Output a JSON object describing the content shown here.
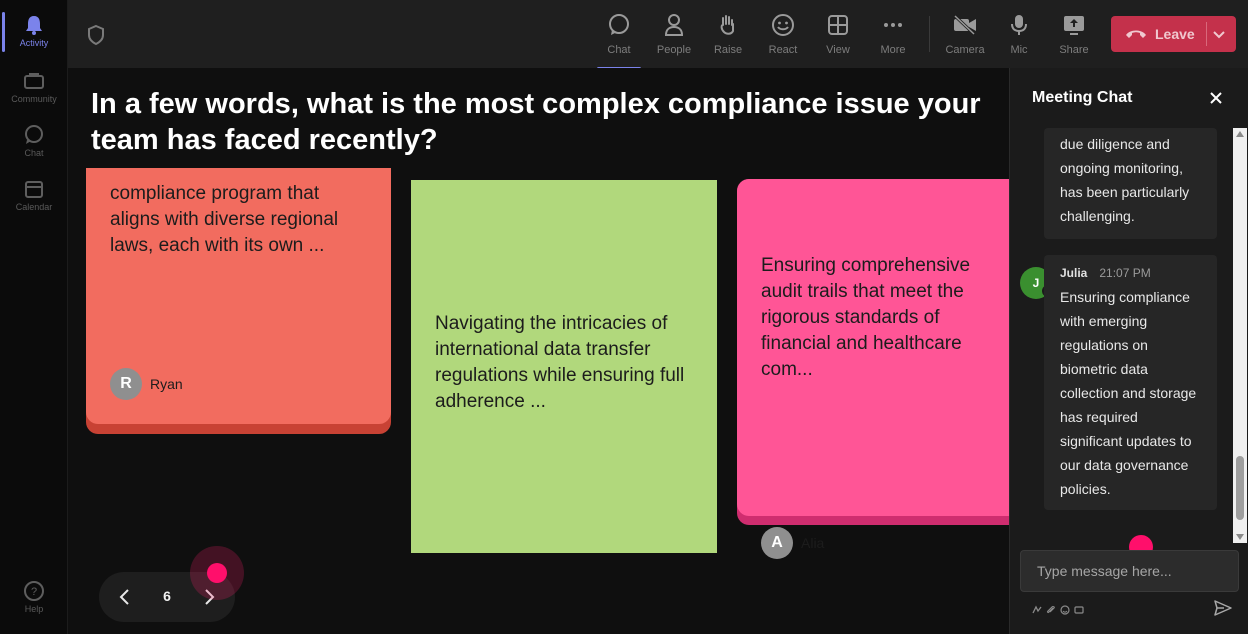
{
  "rail": {
    "items": [
      {
        "label": "Activity",
        "icon": "bell-icon"
      },
      {
        "label": "Community",
        "icon": "community-icon"
      },
      {
        "label": "Chat",
        "icon": "chat-icon"
      },
      {
        "label": "Calendar",
        "icon": "calendar-icon"
      }
    ],
    "help": {
      "label": "Help",
      "icon": "help-icon"
    }
  },
  "toolbar": {
    "chat": "Chat",
    "people": "People",
    "raise": "Raise",
    "react": "React",
    "view": "View",
    "more": "More",
    "camera": "Camera",
    "mic": "Mic",
    "share": "Share",
    "leave": "Leave"
  },
  "stage": {
    "question": "In a few words, what is the most complex compliance issue your team has faced recently?",
    "notes": [
      {
        "text": "compliance program that aligns with diverse regional laws, each with its own ...",
        "author": "Ryan",
        "initial": "R",
        "color": "#f26c5f"
      },
      {
        "text": "Navigating the intricacies of international data transfer regulations while ensuring full adherence ...",
        "color": "#b1d87c"
      },
      {
        "text": "Ensuring comprehensive audit trails that meet the rigorous standards of financial and healthcare com...",
        "author": "Alia",
        "initial": "A",
        "color": "#ff5596"
      }
    ],
    "pager": {
      "page": "6"
    }
  },
  "chat": {
    "title": "Meeting Chat",
    "messages": [
      {
        "text": "due diligence and ongoing monitoring, has been particularly challenging."
      },
      {
        "author": "Julia",
        "initial": "J",
        "time": "21:07 PM",
        "text": "Ensuring compliance with emerging regulations on biometric data collection and storage has required significant updates to our data governance policies."
      }
    ],
    "input_placeholder": "Type message here..."
  },
  "colors": {
    "accent": "#7b83eb",
    "leave": "#c4314b",
    "cursor": "#ff0f6b"
  }
}
